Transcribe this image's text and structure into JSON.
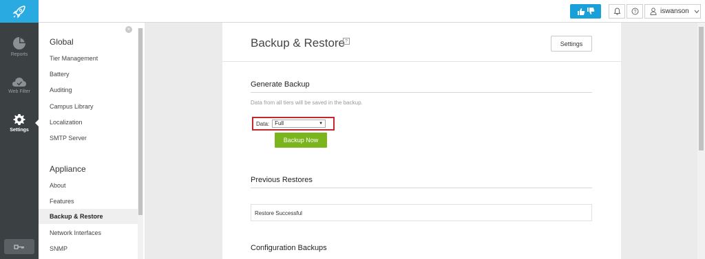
{
  "topbar": {
    "user_name": "iswanson"
  },
  "leftnav": {
    "items": [
      {
        "label": "Reports",
        "icon": "pie-chart-icon"
      },
      {
        "label": "Web Filter",
        "icon": "cloud-icon"
      },
      {
        "label": "Settings",
        "icon": "gear-icon"
      }
    ]
  },
  "submenu": {
    "global_heading": "Global",
    "global_items": [
      "Tier Management",
      "Battery",
      "Auditing",
      "Campus Library",
      "Localization",
      "SMTP Server"
    ],
    "appliance_heading": "Appliance",
    "appliance_items": [
      "About",
      "Features",
      "Backup & Restore",
      "Network Interfaces",
      "SNMP"
    ]
  },
  "main": {
    "title": "Backup & Restore",
    "help_icon": "?",
    "settings_button": "Settings",
    "generate": {
      "title": "Generate Backup",
      "description": "Data from all tiers will be saved in the backup.",
      "data_label": "Data:",
      "data_value": "Full",
      "button": "Backup Now"
    },
    "previous": {
      "title": "Previous Restores",
      "entry": "Restore Successful"
    },
    "config": {
      "title": "Configuration Backups"
    }
  },
  "colors": {
    "brand": "#29abe2",
    "nav_bg": "#3b4043",
    "primary_button": "#7ab51d",
    "highlight_border": "#c0282d"
  }
}
